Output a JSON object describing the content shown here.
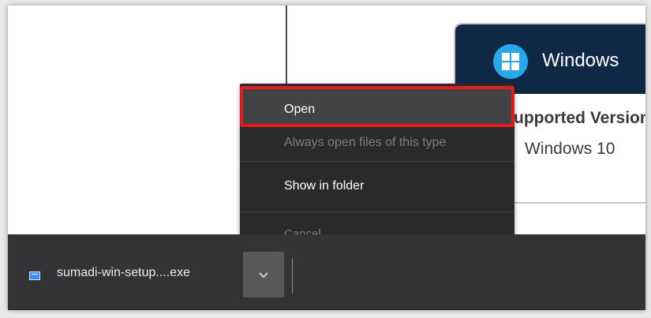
{
  "card": {
    "title": "Windows",
    "supported_label": "Supported Versions",
    "version": "Windows 10",
    "logo_icon": "windows-logo-icon"
  },
  "context_menu": {
    "items": [
      {
        "label": "Open",
        "state": "highlighted"
      },
      {
        "label": "Always open files of this type",
        "state": "disabled"
      },
      {
        "label": "Show in folder",
        "state": "enabled"
      },
      {
        "label": "Cancel",
        "state": "disabled"
      }
    ],
    "highlight_color": "#e01b1b"
  },
  "download_shelf": {
    "file_name": "sumadi-win-setup....exe",
    "file_icon": "exe-file-icon",
    "menu_icon": "chevron-down-icon"
  }
}
